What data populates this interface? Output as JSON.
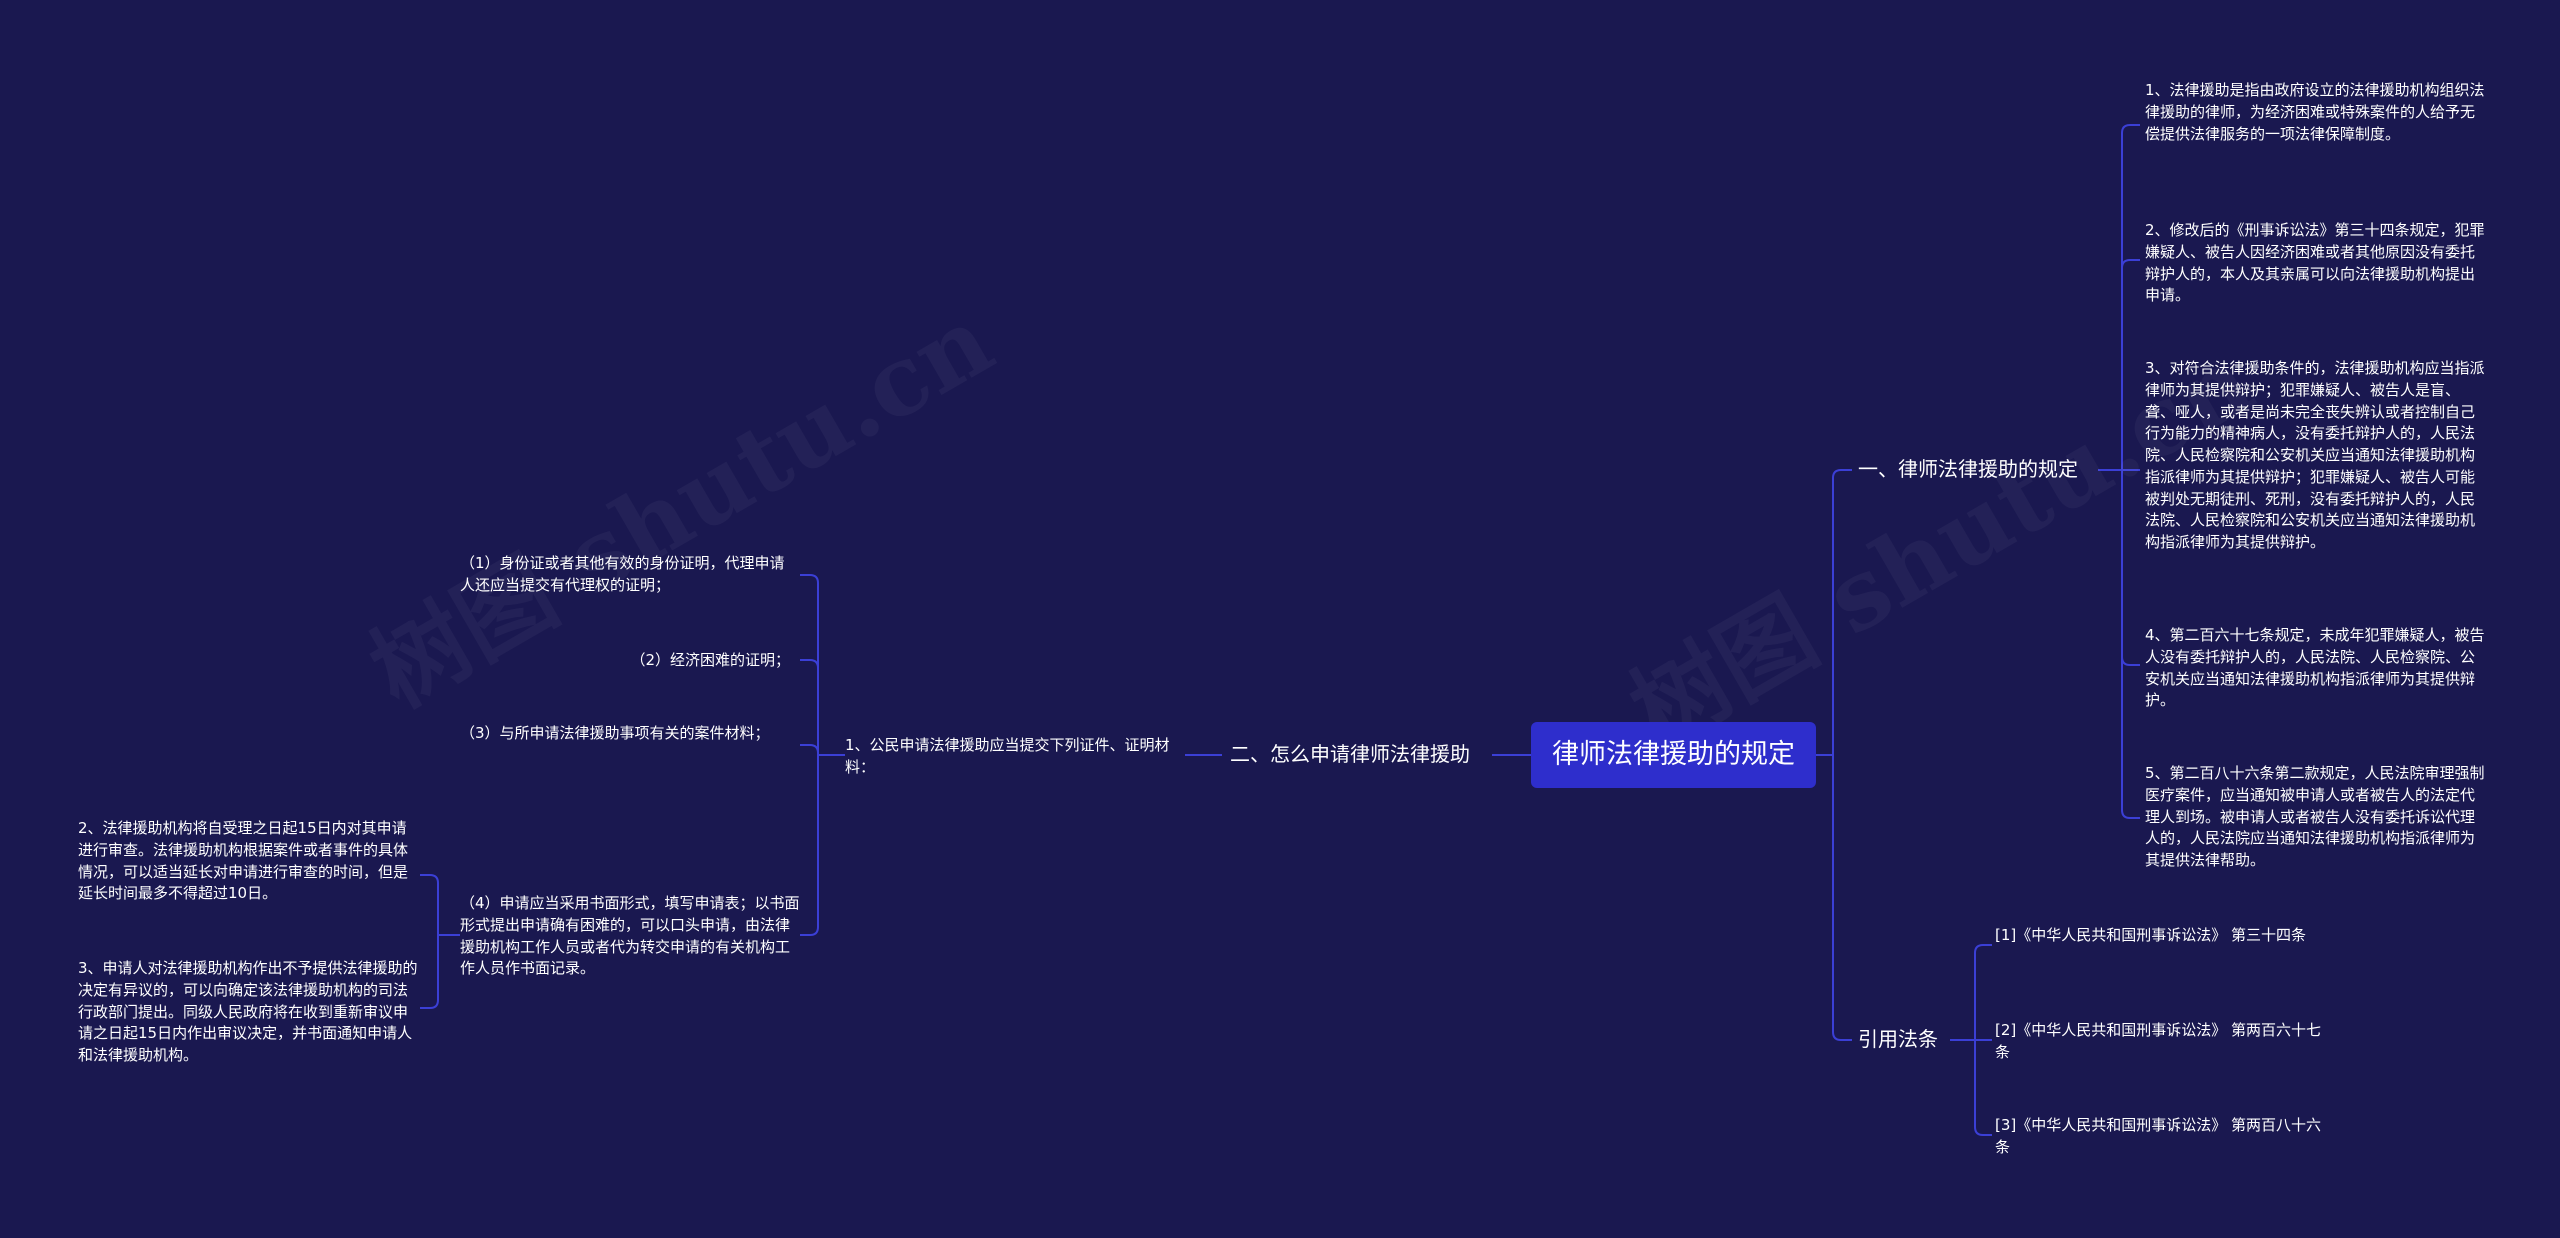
{
  "watermarks": [
    "树图 shutu.cn",
    "树图 shutu.cn"
  ],
  "root": {
    "label": "律师法律援助的规定"
  },
  "right_branches": [
    {
      "label": "一、律师法律援助的规定",
      "children": [
        "1、法律援助是指由政府设立的法律援助机构组织法律援助的律师，为经济困难或特殊案件的人给予无偿提供法律服务的一项法律保障制度。",
        "2、修改后的《刑事诉讼法》第三十四条规定，犯罪嫌疑人、被告人因经济困难或者其他原因没有委托辩护人的，本人及其亲属可以向法律援助机构提出申请。",
        "3、对符合法律援助条件的，法律援助机构应当指派律师为其提供辩护；犯罪嫌疑人、被告人是盲、聋、哑人，或者是尚未完全丧失辨认或者控制自己行为能力的精神病人，没有委托辩护人的，人民法院、人民检察院和公安机关应当通知法律援助机构指派律师为其提供辩护；犯罪嫌疑人、被告人可能被判处无期徒刑、死刑，没有委托辩护人的，人民法院、人民检察院和公安机关应当通知法律援助机构指派律师为其提供辩护。",
        "4、第二百六十七条规定，未成年犯罪嫌疑人，被告人没有委托辩护人的，人民法院、人民检察院、公安机关应当通知法律援助机构指派律师为其提供辩护。",
        "5、第二百八十六条第二款规定，人民法院审理强制医疗案件，应当通知被申请人或者被告人的法定代理人到场。被申请人或者被告人没有委托诉讼代理人的，人民法院应当通知法律援助机构指派律师为其提供法律帮助。"
      ]
    },
    {
      "label": "引用法条",
      "children": [
        "[1]《中华人民共和国刑事诉讼法》 第三十四条",
        "[2]《中华人民共和国刑事诉讼法》 第两百六十七条",
        "[3]《中华人民共和国刑事诉讼法》 第两百八十六条"
      ]
    }
  ],
  "left_branch": {
    "label": "二、怎么申请律师法律援助",
    "sub": {
      "label": "1、公民申请法律援助应当提交下列证件、证明材料：",
      "children": [
        "（1）身份证或者其他有效的身份证明，代理申请人还应当提交有代理权的证明；",
        "（2）经济困难的证明；",
        "（3）与所申请法律援助事项有关的案件材料；",
        "（4）申请应当采用书面形式，填写申请表；以书面形式提出申请确有困难的，可以口头申请，由法律援助机构工作人员或者代为转交申请的有关机构工作人员作书面记录。"
      ],
      "grandchildren": [
        "2、法律援助机构将自受理之日起15日内对其申请进行审查。法律援助机构根据案件或者事件的具体情况，可以适当延长对申请进行审查的时间，但是延长时间最多不得超过10日。",
        "3、申请人对法律援助机构作出不予提供法律援助的决定有异议的，可以向确定该法律援助机构的司法行政部门提出。同级人民政府将在收到重新审议申请之日起15日内作出审议决定，并书面通知申请人和法律援助机构。"
      ]
    }
  },
  "colors": {
    "background": "#1a1850",
    "root": "#2e2ecc",
    "line": "#3b3fd6",
    "text": "#ffffff"
  }
}
